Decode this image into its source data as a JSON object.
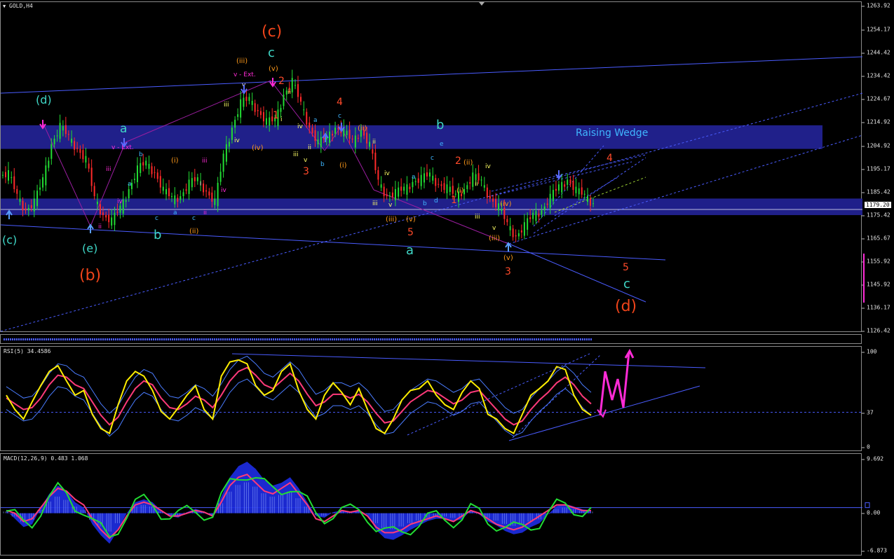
{
  "symbol_label": "GOLD,H4",
  "current_price": "1179.20",
  "main_axis_ticks": [
    "1263.92",
    "1254.17",
    "1244.42",
    "1234.42",
    "1224.67",
    "1214.92",
    "1204.92",
    "1195.17",
    "1185.42",
    "1175.42",
    "1165.67",
    "1155.92",
    "1145.92",
    "1136.17",
    "1126.42"
  ],
  "rsi_title": "RSI(5) 34.4586",
  "rsi_axis_ticks": [
    "100",
    "37",
    "0"
  ],
  "macd_title": "MACD(12,26,9) 0.483 1.068",
  "macd_axis_ticks": [
    "9.692",
    "0.00",
    "-6.873"
  ],
  "zone_label": "Raising Wedge",
  "annotations": [
    {
      "t": "(c)",
      "c": "#f0441a",
      "s": 22
    },
    {
      "t": "c",
      "c": "#3fd6c6",
      "s": 18
    },
    {
      "t": "(iii)",
      "c": "#ff9a1a",
      "s": 10
    },
    {
      "t": "(v)",
      "c": "#ff9a1a",
      "s": 10
    },
    {
      "t": "v - Ext.",
      "c": "#ff2bd6",
      "s": 9
    },
    {
      "t": "v",
      "c": "#ffffff",
      "s": 9
    },
    {
      "t": "2",
      "c": "#ff4a2a",
      "s": 14
    },
    {
      "t": "(d)",
      "c": "#3fd6c6",
      "s": 16
    },
    {
      "t": "a",
      "c": "#3fd6c6",
      "s": 17
    },
    {
      "t": "v - Ext.",
      "c": "#ff2bd6",
      "s": 9
    },
    {
      "t": "b",
      "c": "#3fb6ff",
      "s": 9
    },
    {
      "t": "iii",
      "c": "#ff2bd6",
      "s": 9
    },
    {
      "t": "a",
      "c": "#3fb6ff",
      "s": 9
    },
    {
      "t": "iv",
      "c": "#ff2bd6",
      "s": 9
    },
    {
      "t": "(i)",
      "c": "#ff9a1a",
      "s": 10
    },
    {
      "t": "iii",
      "c": "#ff2bd6",
      "s": 9
    },
    {
      "t": "i",
      "c": "#ff2bd6",
      "s": 9
    },
    {
      "t": "iv",
      "c": "#ff2bd6",
      "s": 9
    },
    {
      "t": "c",
      "c": "#3fb6ff",
      "s": 9
    },
    {
      "t": "a",
      "c": "#3fb6ff",
      "s": 9
    },
    {
      "t": "c",
      "c": "#3fb6ff",
      "s": 9
    },
    {
      "t": "ii",
      "c": "#ff2bd6",
      "s": 9
    },
    {
      "t": "(ii)",
      "c": "#ff9a1a",
      "s": 10
    },
    {
      "t": "b",
      "c": "#3fd6c6",
      "s": 18
    },
    {
      "t": "(c)",
      "c": "#3fd6c6",
      "s": 16
    },
    {
      "t": "(e)",
      "c": "#3fd6c6",
      "s": 16
    },
    {
      "t": "(b)",
      "c": "#f0441a",
      "s": 22
    },
    {
      "t": "ii",
      "c": "#ff2bd6",
      "s": 9
    },
    {
      "t": "iii",
      "c": "#ffff66",
      "s": 9
    },
    {
      "t": "iv",
      "c": "#ffff66",
      "s": 9
    },
    {
      "t": "ii",
      "c": "#ffff66",
      "s": 9
    },
    {
      "t": "(iv)",
      "c": "#ff9a1a",
      "s": 10
    },
    {
      "t": "1",
      "c": "#ff4a2a",
      "s": 14
    },
    {
      "t": "i",
      "c": "#ffff66",
      "s": 9
    },
    {
      "t": "iv",
      "c": "#ffff66",
      "s": 9
    },
    {
      "t": "ii",
      "c": "#ffff66",
      "s": 9
    },
    {
      "t": "iii",
      "c": "#ffff66",
      "s": 9
    },
    {
      "t": "v",
      "c": "#ffff66",
      "s": 9
    },
    {
      "t": "3",
      "c": "#ff4a2a",
      "s": 14
    },
    {
      "t": "b",
      "c": "#3fb6ff",
      "s": 9
    },
    {
      "t": "a",
      "c": "#3fb6ff",
      "s": 9
    },
    {
      "t": "c",
      "c": "#3fb6ff",
      "s": 9
    },
    {
      "t": "4",
      "c": "#ff4a2a",
      "s": 14
    },
    {
      "t": "(ii)",
      "c": "#ff9a1a",
      "s": 10
    },
    {
      "t": "(i)",
      "c": "#ff9a1a",
      "s": 10
    },
    {
      "t": "ii",
      "c": "#ffff66",
      "s": 9
    },
    {
      "t": "b",
      "c": "#3fd6c6",
      "s": 18
    },
    {
      "t": "e",
      "c": "#3fb6ff",
      "s": 9
    },
    {
      "t": "c",
      "c": "#3fb6ff",
      "s": 9
    },
    {
      "t": "a",
      "c": "#3fb6ff",
      "s": 9
    },
    {
      "t": "iv",
      "c": "#ffff66",
      "s": 9
    },
    {
      "t": "iii",
      "c": "#ffff66",
      "s": 9
    },
    {
      "t": "v",
      "c": "#ffff66",
      "s": 9
    },
    {
      "t": "b",
      "c": "#3fb6ff",
      "s": 9
    },
    {
      "t": "d",
      "c": "#3fb6ff",
      "s": 9
    },
    {
      "t": "(iii)",
      "c": "#ff9a1a",
      "s": 10
    },
    {
      "t": "(v)",
      "c": "#ff9a1a",
      "s": 10
    },
    {
      "t": "5",
      "c": "#ff4a2a",
      "s": 14
    },
    {
      "t": "a",
      "c": "#3fd6c6",
      "s": 18
    },
    {
      "t": "2",
      "c": "#ff4a2a",
      "s": 14
    },
    {
      "t": "(ii)",
      "c": "#ff9a1a",
      "s": 10
    },
    {
      "t": "(i)",
      "c": "#ff9a1a",
      "s": 10
    },
    {
      "t": "1",
      "c": "#ff4a2a",
      "s": 14
    },
    {
      "t": "ii",
      "c": "#ffff66",
      "s": 9
    },
    {
      "t": "iv",
      "c": "#ffff66",
      "s": 9
    },
    {
      "t": "iii",
      "c": "#ffff66",
      "s": 9
    },
    {
      "t": "(iv)",
      "c": "#ff9a1a",
      "s": 10
    },
    {
      "t": "v",
      "c": "#ffff66",
      "s": 9
    },
    {
      "t": "(iii)",
      "c": "#ff9a1a",
      "s": 10
    },
    {
      "t": "(v)",
      "c": "#ff9a1a",
      "s": 10
    },
    {
      "t": "3",
      "c": "#ff4a2a",
      "s": 14
    },
    {
      "t": "4",
      "c": "#ff4a2a",
      "s": 14
    },
    {
      "t": "5",
      "c": "#ff4a2a",
      "s": 14
    },
    {
      "t": "c",
      "c": "#3fd6c6",
      "s": 18
    },
    {
      "t": "(d)",
      "c": "#f0441a",
      "s": 22
    }
  ],
  "chart_data": {
    "type": "line",
    "symbol": "GOLD",
    "timeframe": "H4",
    "price_ylim": [
      1126.42,
      1263.92
    ],
    "price_close": [
      1192,
      1183,
      1177,
      1180,
      1190,
      1205,
      1212,
      1208,
      1203,
      1198,
      1182,
      1175,
      1172,
      1178,
      1186,
      1194,
      1197,
      1193,
      1185,
      1182,
      1183,
      1188,
      1190,
      1185,
      1180,
      1200,
      1212,
      1222,
      1224,
      1219,
      1214,
      1215,
      1226,
      1231,
      1222,
      1212,
      1205,
      1208,
      1212,
      1210,
      1206,
      1211,
      1204,
      1189,
      1183,
      1184,
      1186,
      1189,
      1190,
      1192,
      1188,
      1186,
      1183,
      1186,
      1191,
      1189,
      1182,
      1178,
      1171,
      1166,
      1170,
      1175,
      1177,
      1182,
      1187,
      1190,
      1185,
      1183,
      1180
    ],
    "zones": [
      {
        "from": 1203,
        "to": 1213
      },
      {
        "from": 1175,
        "to": 1182
      }
    ],
    "rsi": {
      "period": 5,
      "value": 34.4586,
      "ylim": [
        0,
        100
      ],
      "level": 37,
      "values": [
        55,
        40,
        30,
        48,
        65,
        80,
        86,
        70,
        55,
        60,
        35,
        20,
        15,
        45,
        70,
        80,
        75,
        60,
        38,
        30,
        42,
        55,
        65,
        40,
        30,
        75,
        90,
        92,
        88,
        65,
        55,
        60,
        80,
        88,
        60,
        40,
        30,
        55,
        68,
        58,
        45,
        62,
        40,
        20,
        15,
        30,
        50,
        60,
        62,
        70,
        55,
        45,
        40,
        58,
        70,
        62,
        35,
        30,
        20,
        15,
        35,
        55,
        62,
        70,
        85,
        82,
        55,
        40,
        34
      ],
      "signal": [
        52,
        46,
        40,
        42,
        52,
        66,
        76,
        74,
        66,
        62,
        48,
        34,
        24,
        32,
        48,
        62,
        70,
        66,
        52,
        42,
        40,
        46,
        54,
        50,
        42,
        55,
        70,
        80,
        84,
        76,
        66,
        62,
        70,
        78,
        70,
        56,
        44,
        48,
        56,
        56,
        52,
        56,
        48,
        36,
        26,
        28,
        38,
        48,
        54,
        60,
        58,
        52,
        46,
        50,
        58,
        60,
        50,
        40,
        30,
        24,
        28,
        40,
        50,
        58,
        68,
        74,
        66,
        54,
        46
      ],
      "projection": [
        34,
        80,
        50,
        72,
        42,
        100
      ]
    },
    "macd": {
      "fast": 12,
      "slow": 26,
      "signal": 9,
      "main": 0.483,
      "signal_value": 1.068,
      "ylim": [
        -6.873,
        9.692
      ],
      "histogram": [
        0.5,
        -1,
        -2.5,
        -2,
        1,
        3.5,
        5,
        4,
        2,
        1,
        -2,
        -4,
        -5.5,
        -3,
        0,
        2,
        2.5,
        2,
        0.5,
        -0.5,
        -0.8,
        0.2,
        0.8,
        0.3,
        -0.5,
        3,
        6.5,
        8.5,
        9.3,
        8,
        6,
        5,
        5.5,
        6.5,
        4.5,
        2,
        -0.5,
        -0.8,
        0.2,
        0.5,
        0.2,
        0.6,
        -0.3,
        -3,
        -4.5,
        -4.8,
        -4,
        -3,
        -2.2,
        -1.4,
        -1,
        -1,
        -1.4,
        -1.1,
        0.5,
        -0.2,
        -1.5,
        -2.2,
        -3.2,
        -3.8,
        -3.5,
        -2.5,
        -1.8,
        -0.2,
        1.3,
        1.7,
        1.2,
        0.7,
        0.5
      ],
      "signal_line": [
        0.5,
        0,
        -1.5,
        -1,
        1,
        3,
        4.5,
        4,
        2.5,
        1.5,
        -1,
        -3,
        -4.5,
        -3,
        -0.5,
        1.5,
        2,
        1.5,
        0.5,
        -0.5,
        -0.5,
        0,
        0.5,
        0.2,
        -0.5,
        2,
        5,
        6.5,
        7,
        5.5,
        4,
        3.5,
        4.5,
        5.5,
        3.5,
        1.5,
        -1,
        -1.5,
        -0.5,
        0.5,
        0.2,
        0.5,
        -0.5,
        -2.5,
        -3.5,
        -3.5,
        -3,
        -2,
        -1.5,
        -1,
        -0.5,
        -1,
        -1.5,
        -0.5,
        0.5,
        0,
        -1,
        -2,
        -2.5,
        -3,
        -2.5,
        -1.5,
        -0.5,
        0.5,
        1.5,
        1.5,
        1,
        0.5,
        0.48
      ]
    }
  }
}
